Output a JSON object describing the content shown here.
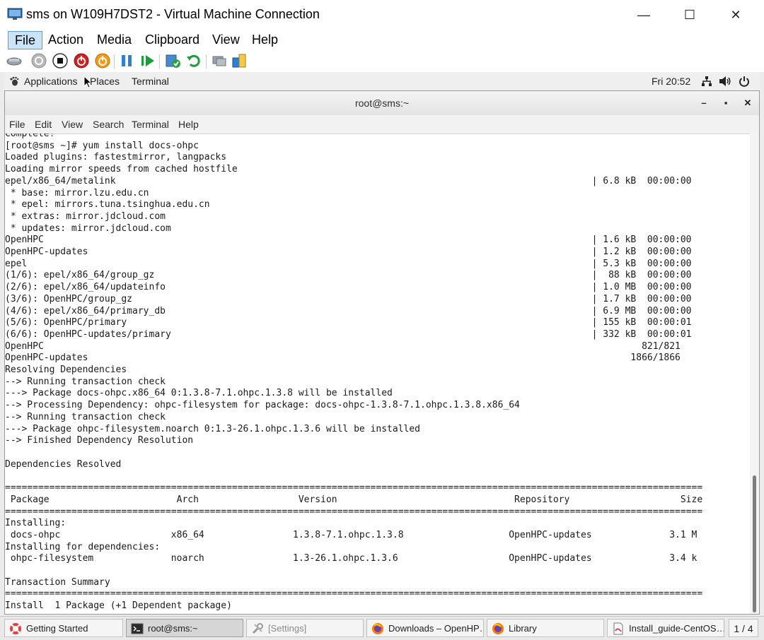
{
  "window": {
    "title": "sms on W109H7DST2 - Virtual Machine Connection",
    "minimize": "—",
    "maximize": "☐",
    "close": "✕"
  },
  "menu": [
    "File",
    "Action",
    "Media",
    "Clipboard",
    "View",
    "Help"
  ],
  "toolbar_icons": [
    "ctrl-alt-del-icon",
    "start-icon",
    "turn-off-icon",
    "shut-down-icon",
    "save-state-icon",
    "pause-icon",
    "resume-icon",
    "checkpoint-icon",
    "revert-icon",
    "basic-session-icon",
    "share-icon"
  ],
  "gnome": {
    "applications": "Applications",
    "places": "Places",
    "terminal": "Terminal",
    "clock": "Fri 20:52"
  },
  "terminal": {
    "title": "root@sms:~",
    "menu": [
      "File",
      "Edit",
      "View",
      "Search",
      "Terminal",
      "Help"
    ],
    "lines": [
      "Complete!",
      "[root@sms ~]# yum install docs-ohpc",
      "Loaded plugins: fastestmirror, langpacks",
      "Loading mirror speeds from cached hostfile",
      "epel/x86_64/metalink                                                                                      | 6.8 kB  00:00:00",
      " * base: mirror.lzu.edu.cn",
      " * epel: mirrors.tuna.tsinghua.edu.cn",
      " * extras: mirror.jdcloud.com",
      " * updates: mirror.jdcloud.com",
      "OpenHPC                                                                                                   | 1.6 kB  00:00:00",
      "OpenHPC-updates                                                                                           | 1.2 kB  00:00:00",
      "epel                                                                                                      | 5.3 kB  00:00:00",
      "(1/6): epel/x86_64/group_gz                                                                               |  88 kB  00:00:00",
      "(2/6): epel/x86_64/updateinfo                                                                             | 1.0 MB  00:00:00",
      "(3/6): OpenHPC/group_gz                                                                                   | 1.7 kB  00:00:00",
      "(4/6): epel/x86_64/primary_db                                                                             | 6.9 MB  00:00:00",
      "(5/6): OpenHPC/primary                                                                                    | 155 kB  00:00:01",
      "(6/6): OpenHPC-updates/primary                                                                            | 332 kB  00:00:01",
      "OpenHPC                                                                                                            821/821",
      "OpenHPC-updates                                                                                                  1866/1866",
      "Resolving Dependencies",
      "--> Running transaction check",
      "---> Package docs-ohpc.x86_64 0:1.3.8-7.1.ohpc.1.3.8 will be installed",
      "--> Processing Dependency: ohpc-filesystem for package: docs-ohpc-1.3.8-7.1.ohpc.1.3.8.x86_64",
      "--> Running transaction check",
      "---> Package ohpc-filesystem.noarch 0:1.3-26.1.ohpc.1.3.6 will be installed",
      "--> Finished Dependency Resolution",
      "",
      "Dependencies Resolved",
      "",
      "==============================================================================================================================",
      " Package                       Arch                  Version                                Repository                    Size",
      "==============================================================================================================================",
      "Installing:",
      " docs-ohpc                    x86_64                1.3.8-7.1.ohpc.1.3.8                   OpenHPC-updates              3.1 M",
      "Installing for dependencies:",
      " ohpc-filesystem              noarch                1.3-26.1.ohpc.1.3.6                    OpenHPC-updates              3.4 k",
      "",
      "Transaction Summary",
      "==============================================================================================================================",
      "Install  1 Package (+1 Dependent package)"
    ]
  },
  "taskbar": {
    "items": [
      {
        "label": "Getting Started",
        "icon": "help-lifebuoy-icon"
      },
      {
        "label": "root@sms:~",
        "icon": "terminal-icon"
      },
      {
        "label": "[Settings]",
        "icon": "settings-tools-icon"
      },
      {
        "label": "Downloads – OpenHP…",
        "icon": "firefox-icon"
      },
      {
        "label": "Library",
        "icon": "firefox-icon"
      },
      {
        "label": "Install_guide-CentOS…",
        "icon": "pdf-document-icon"
      }
    ],
    "workspace": "1 / 4"
  }
}
